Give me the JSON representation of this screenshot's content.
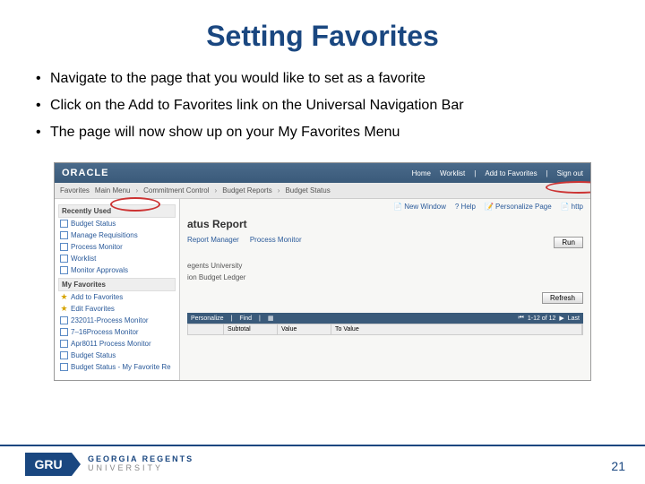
{
  "title": "Setting Favorites",
  "bullets": [
    "Navigate to the page that you would like to set as a favorite",
    "Click on the Add to Favorites link on the Universal Navigation Bar",
    "The page will now show up on your My Favorites Menu"
  ],
  "screenshot": {
    "oracle_logo": "ORACLE",
    "top_links": {
      "home": "Home",
      "worklist": "Worklist",
      "add_fav": "Add to Favorites",
      "signout": "Sign out"
    },
    "breadcrumb": {
      "favorites": "Favorites",
      "main_menu": "Main Menu",
      "cc": "Commitment Control",
      "br": "Budget Reports",
      "bs": "Budget Status"
    },
    "utilities": {
      "new_window": "New Window",
      "help": "? Help",
      "personalize": "Personalize Page",
      "http": "http"
    },
    "sidebar": {
      "recent_title": "Recently Used",
      "recent": [
        "Budget Status",
        "Manage Requisitions",
        "Process Monitor",
        "Worklist",
        "Monitor Approvals"
      ],
      "fav_title": "My Favorites",
      "favs": [
        "Add to Favorites",
        "Edit Favorites",
        "232011-Process Monitor",
        "7–16Process Monitor",
        "Apr8011 Process Monitor",
        "Budget Status",
        "Budget Status - My Favorite Re"
      ]
    },
    "panel": {
      "title": "atus Report",
      "report_mgr": "Report Manager",
      "proc_mon": "Process Monitor",
      "run": "Run",
      "field1_label": "egents University",
      "field2_label": "ion Budget Ledger",
      "refresh": "Refresh",
      "grid_link1": "Personalize",
      "grid_link2": "Find",
      "grid_nav": "1-12 of 12",
      "grid_last": "Last",
      "col1": "Subtotal",
      "col2": "Value",
      "col3": "To Value"
    }
  },
  "footer": {
    "gru": "GRU",
    "line1": "GEORGIA REGENTS",
    "line2": "UNIVERSITY"
  },
  "page_number": "21"
}
